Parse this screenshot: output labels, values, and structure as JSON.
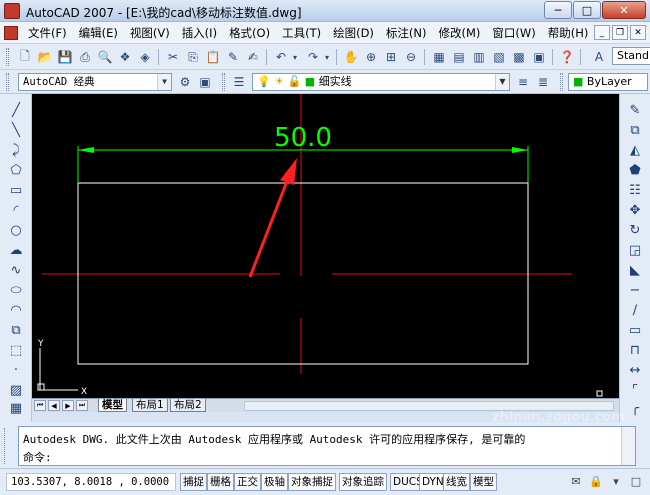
{
  "window": {
    "title": "AutoCAD 2007 - [E:\\我的cad\\移动标注数值.dwg]",
    "controls": [
      "minimize",
      "maximize",
      "close"
    ]
  },
  "menu": {
    "items": [
      "文件(F)",
      "编辑(E)",
      "视图(V)",
      "插入(I)",
      "格式(O)",
      "工具(T)",
      "绘图(D)",
      "标注(N)",
      "修改(M)",
      "窗口(W)",
      "帮助(H)"
    ]
  },
  "toolbar1": {
    "style_combo": "Stand"
  },
  "toolbar2": {
    "workspace": "AutoCAD 经典",
    "layer": "细实线",
    "color": "ByLayer"
  },
  "drawing": {
    "dimension_text": "50.0",
    "dimension_color": "#00ff00",
    "rectangle_color": "#ffffff",
    "centerline_color": "#ff0000",
    "arrow_color": "#ff0000",
    "ucs_y": "Y",
    "ucs_x": "X"
  },
  "layout_tabs": [
    "模型",
    "布局1",
    "布局2"
  ],
  "command": {
    "history": "Autodesk DWG.  此文件上次由 Autodesk 应用程序或 Autodesk 许可的应用程序保存, 是可靠的",
    "prompt": "命令:"
  },
  "status": {
    "coordinates": "103.5307, 8.0018 , 0.0000",
    "toggles": [
      "捕捉",
      "栅格",
      "正交",
      "极轴",
      "对象捕捉",
      "对象追踪",
      "DUCS",
      "DYN",
      "线宽",
      "模型"
    ]
  },
  "watermark": "zhinan.sogou.com"
}
